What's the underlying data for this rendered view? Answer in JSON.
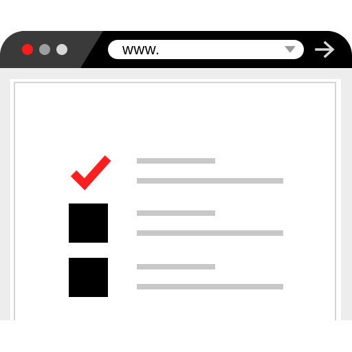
{
  "browser": {
    "window_controls": {
      "close": {
        "color": "#ff1c1c",
        "icon": "close-dot-icon"
      },
      "minimize": {
        "color": "#9e9e9e",
        "icon": "minimize-dot-icon"
      },
      "maximize": {
        "color": "#d8d8d8",
        "icon": "maximize-dot-icon"
      }
    },
    "address_bar": {
      "value": "www.",
      "dropdown_icon": "chevron-down-icon"
    },
    "go_button_icon": "arrow-right-icon"
  },
  "checklist": {
    "items": [
      {
        "state": "checked",
        "icon": "checkmark-icon",
        "color": "#ff1f1f"
      },
      {
        "state": "unchecked",
        "icon": "checkbox-icon",
        "color": "#000000"
      },
      {
        "state": "unchecked",
        "icon": "checkbox-icon",
        "color": "#000000"
      }
    ],
    "placeholder_line_color": "#c8c8c8"
  }
}
